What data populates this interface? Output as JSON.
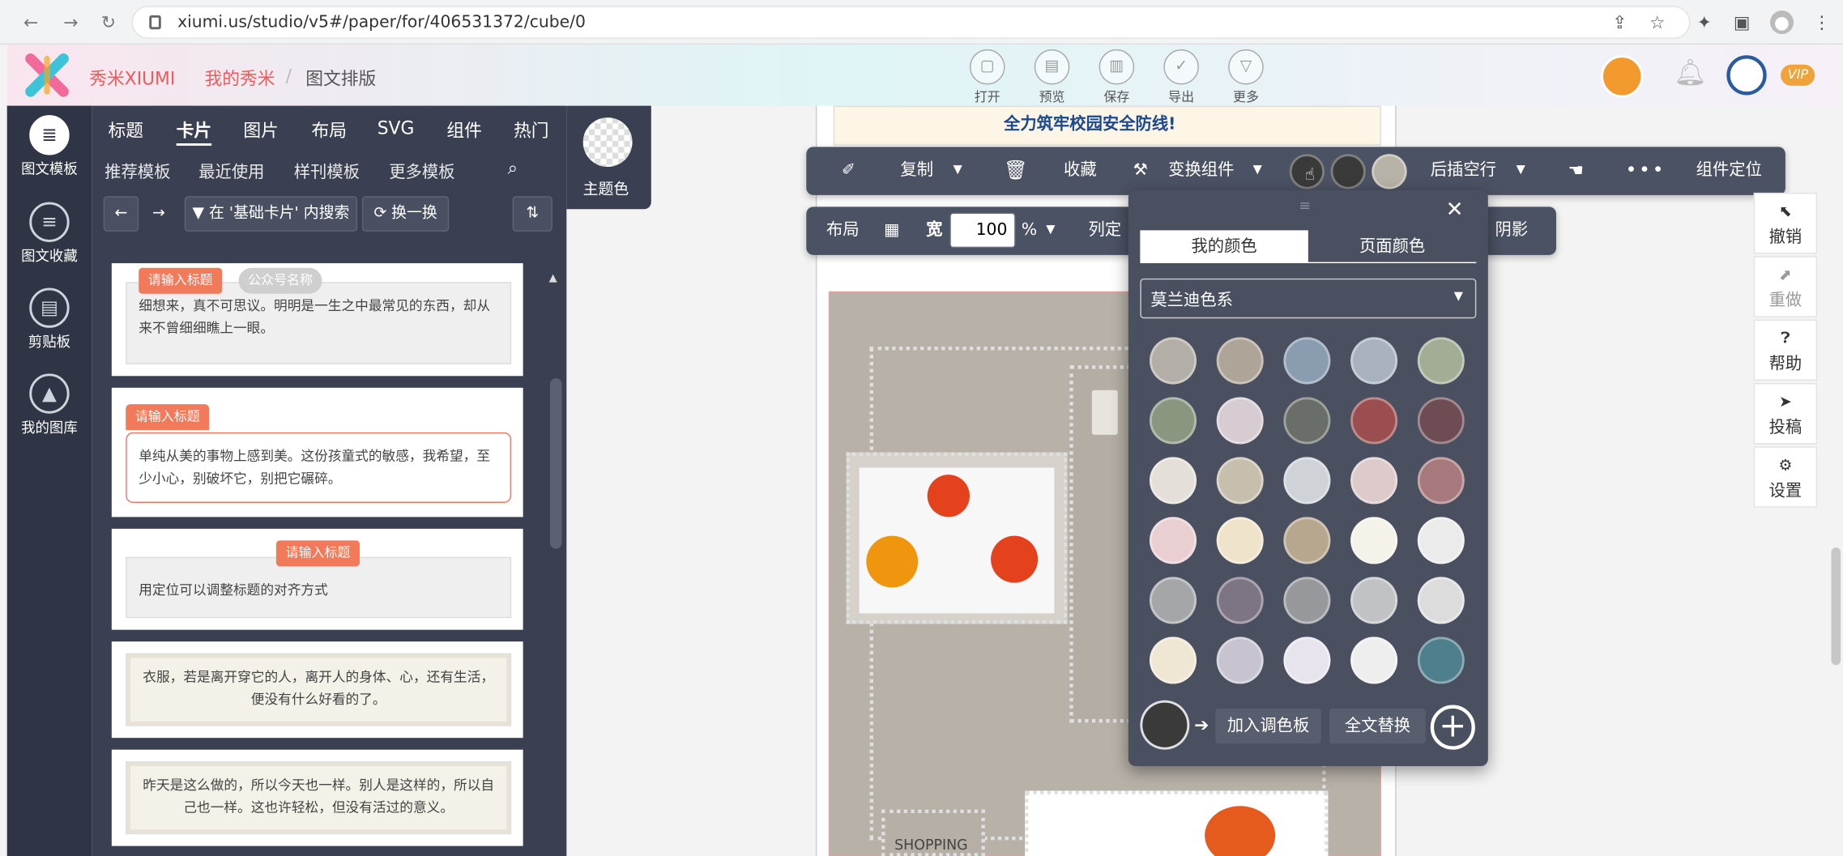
{
  "browser": {
    "url": "xiumi.us/studio/v5#/paper/for/406531372/cube/0"
  },
  "header": {
    "brand": "秀米XIUMI",
    "links": [
      "我的秀米",
      "图文排版"
    ],
    "tools": [
      {
        "label": "打开",
        "icon": "folder-icon"
      },
      {
        "label": "预览",
        "icon": "preview-icon"
      },
      {
        "label": "保存",
        "icon": "save-icon"
      },
      {
        "label": "导出",
        "icon": "check-icon"
      },
      {
        "label": "更多",
        "icon": "more-triangle-icon"
      }
    ],
    "vip": "VIP"
  },
  "leftnav": [
    {
      "label": "图文模板",
      "icon": "list-icon",
      "active": true
    },
    {
      "label": "图文收藏",
      "icon": "favorites-icon",
      "active": false
    },
    {
      "label": "剪贴板",
      "icon": "clipboard-icon",
      "active": false
    },
    {
      "label": "我的图库",
      "icon": "gallery-icon",
      "active": false
    }
  ],
  "panel": {
    "tabs": [
      "标题",
      "卡片",
      "图片",
      "布局",
      "SVG",
      "组件",
      "热门"
    ],
    "active_tab": "卡片",
    "subtabs": [
      "推荐模板",
      "最近使用",
      "样刊模板",
      "更多模板"
    ],
    "search_scope": "在 '基础卡片' 内搜索",
    "shuffle": "换一换",
    "theme_color": "主题色"
  },
  "cards": [
    {
      "tag": "请输入标题",
      "tag2": "公众号名称",
      "text": "细想来，真不可思议。明明是一生之中最常见的东西，却从来不曾细细瞧上一眼。"
    },
    {
      "tag": "请输入标题",
      "text": "单纯从美的事物上感到美。这份孩童式的敏感，我希望，至少小心，别破坏它，别把它碾碎。"
    },
    {
      "tag": "请输入标题",
      "text": "用定位可以调整标题的对齐方式"
    },
    {
      "text": "衣服，若是离开穿它的人，离开人的身体、心，还有生活，便没有什么好看的了。"
    },
    {
      "text": "昨天是这么做的，所以今天也一样。别人是这样的，所以自己也一样。这也许轻松，但没有活过的意义。"
    }
  ],
  "canvas": {
    "banner": "全力筑牢校园安全防线!",
    "shopping": "SHOPPING"
  },
  "toolbar": {
    "copy": "复制",
    "collect": "收藏",
    "transform": "变换组件",
    "insert_after": "后插空行",
    "locate": "组件定位",
    "layout": "布局",
    "width_label": "宽",
    "width_value": "100",
    "unit": "%",
    "col_label": "列定",
    "shadow": "阴影"
  },
  "colors": {
    "current": [
      "#3a3a3a",
      "#3a3a3a",
      "#b8b3a8"
    ],
    "tabs": [
      "我的颜色",
      "页面颜色"
    ],
    "palette_name": "莫兰迪色系",
    "palette": [
      "#b3aea7",
      "#aea497",
      "#8a9cb0",
      "#a9b3c0",
      "#a3ad96",
      "#8a9680",
      "#d6ccd2",
      "#6a6e68",
      "#9b4e4f",
      "#6e4c54",
      "#e4dfd9",
      "#c7bfae",
      "#cfd2d6",
      "#ddcaca",
      "#a7797d",
      "#e9cfd1",
      "#f0e3cb",
      "#b7a78e",
      "#f5f2ea",
      "#ebebeb",
      "#a4a6a8",
      "#7e7584",
      "#96989b",
      "#c1c2c4",
      "#dcdcdd",
      "#f0e6d4",
      "#c7c3cf",
      "#e8e4ee",
      "#eeeeef",
      "#4f7f8c"
    ],
    "selected": "#3a3a3a",
    "add_to_palette": "加入调色板",
    "replace_all": "全文替换"
  },
  "rightrail": [
    {
      "label": "撤销",
      "icon": "undo-icon"
    },
    {
      "label": "重做",
      "icon": "redo-icon"
    },
    {
      "label": "帮助",
      "icon": "help-icon"
    },
    {
      "label": "投稿",
      "icon": "submit-icon"
    },
    {
      "label": "设置",
      "icon": "settings-icon"
    }
  ]
}
